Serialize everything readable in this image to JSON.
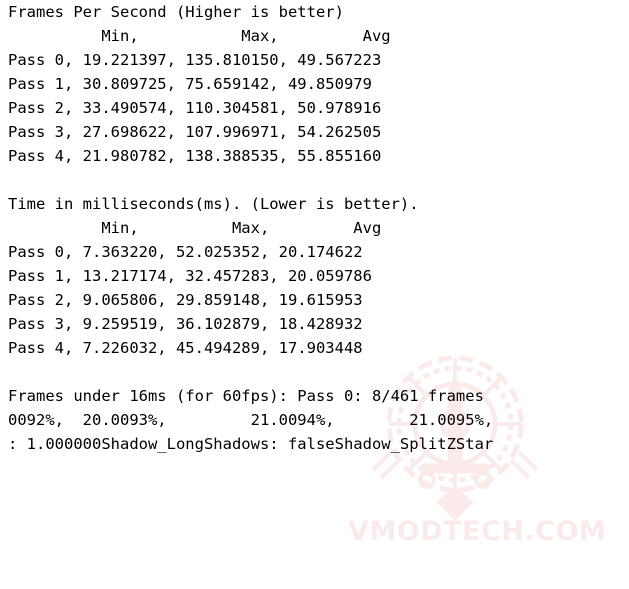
{
  "console": {
    "background_color": "#ffffff",
    "text_color": "#000000",
    "fps_section": {
      "title": "Frames Per Second (Higher is better)",
      "header": "          Min,           Max,         Avg",
      "rows": [
        "Pass 0, 19.221397, 135.810150, 49.567223",
        "Pass 1, 30.809725, 75.659142, 49.850979",
        "Pass 2, 33.490574, 110.304581, 50.978916",
        "Pass 3, 27.698622, 107.996971, 54.262505",
        "Pass 4, 21.980782, 138.388535, 55.855160"
      ]
    },
    "time_section": {
      "title": "Time in milliseconds(ms). (Lower is better).",
      "header": "          Min,          Max,         Avg",
      "rows": [
        "Pass 0, 7.363220, 52.025352, 20.174622",
        "Pass 1, 13.217174, 32.457283, 20.059786",
        "Pass 2, 9.065806, 29.859148, 19.615953",
        "Pass 3, 9.259519, 36.102879, 18.428932",
        "Pass 4, 7.226032, 45.494289, 17.903448"
      ]
    },
    "footer_section": {
      "line1": "Frames under 16ms (for 60fps): Pass 0: 8/461 frames",
      "line2": "0092%,  20.0093%,         21.0094%,        21.0095%,",
      "line3": ": 1.000000Shadow_LongShadows: falseShadow_SplitZStar"
    }
  },
  "watermark": {
    "text": "VMODTECH.COM",
    "color": "#d4453f",
    "emblem_name": "vmodtech-circular-emblem"
  },
  "chart_data": {
    "type": "table",
    "title": "Benchmark results — Frames Per Second and Frame Time",
    "tables": [
      {
        "name": "Frames Per Second (Higher is better)",
        "unit": "fps",
        "columns": [
          "Pass",
          "Min",
          "Max",
          "Avg"
        ],
        "rows": [
          [
            "Pass 0",
            19.221397,
            135.81015,
            49.567223
          ],
          [
            "Pass 1",
            30.809725,
            75.659142,
            49.850979
          ],
          [
            "Pass 2",
            33.490574,
            110.304581,
            50.978916
          ],
          [
            "Pass 3",
            27.698622,
            107.996971,
            54.262505
          ],
          [
            "Pass 4",
            21.980782,
            138.388535,
            55.85516
          ]
        ]
      },
      {
        "name": "Time in milliseconds(ms). (Lower is better).",
        "unit": "ms",
        "columns": [
          "Pass",
          "Min",
          "Max",
          "Avg"
        ],
        "rows": [
          [
            "Pass 0",
            7.36322,
            52.025352,
            20.174622
          ],
          [
            "Pass 1",
            13.217174,
            32.457283,
            20.059786
          ],
          [
            "Pass 2",
            9.065806,
            29.859148,
            19.615953
          ],
          [
            "Pass 3",
            9.259519,
            36.102879,
            18.428932
          ],
          [
            "Pass 4",
            7.226032,
            45.494289,
            17.903448
          ]
        ]
      }
    ],
    "annotations": {
      "frames_under_16ms_label": "Frames under 16ms (for 60fps)",
      "frames_under_16ms_pass0": "8/461 frames",
      "percentages": [
        "0092%",
        "20.0093%",
        "21.0094%",
        "21.0095%"
      ],
      "settings": [
        "1.000000",
        "Shadow_LongShadows: false",
        "Shadow_SplitZStar"
      ]
    }
  }
}
